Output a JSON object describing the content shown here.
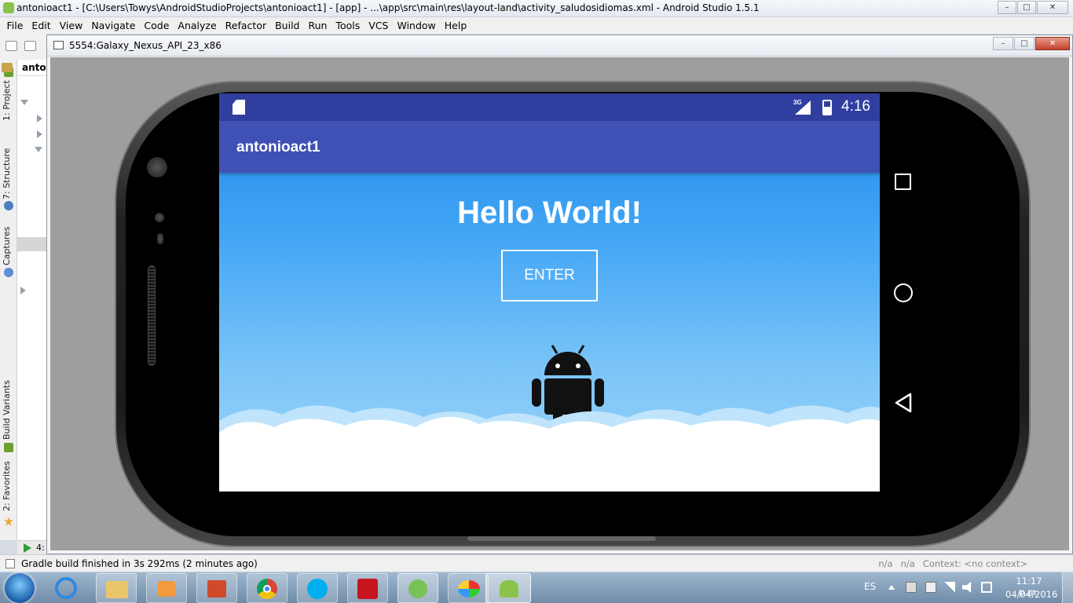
{
  "studio": {
    "window_title": "antonioact1 - [C:\\Users\\Towys\\AndroidStudioProjects\\antonioact1] - [app] - ...\\app\\src\\main\\res\\layout-land\\activity_saludosidiomas.xml - Android Studio 1.5.1",
    "window_buttons": {
      "minimize": "–",
      "maximize": "□",
      "close": "✕"
    },
    "menu": [
      "File",
      "Edit",
      "View",
      "Navigate",
      "Code",
      "Analyze",
      "Refactor",
      "Build",
      "Run",
      "Tools",
      "VCS",
      "Window",
      "Help"
    ],
    "project_label": "anton",
    "side_tabs": {
      "project": "1: Project",
      "structure": "7: Structure",
      "captures": "Captures",
      "build_variants": "Build Variants",
      "favorites": "2: Favorites"
    },
    "run_tab_number": "4:",
    "status_message": "Gradle build finished in 3s 292ms (2 minutes ago)",
    "status_right": [
      "n/a",
      "n/a",
      "Context: <no context>"
    ]
  },
  "emulator": {
    "window_title": "5554:Galaxy_Nexus_API_23_x86",
    "window_buttons": {
      "minimize": "–",
      "maximize": "□",
      "close": "✕"
    },
    "device": {
      "status_bar": {
        "network": "3G",
        "time": "4:16"
      },
      "app_title": "antonioact1",
      "hello_text": "Hello World!",
      "enter_button": "ENTER",
      "colors": {
        "status_bar": "#303f9f",
        "app_bar": "#3f51b5",
        "sky_top": "#1e88e5",
        "sky_bottom": "#9fd6fa"
      }
    },
    "nav_icons": [
      "recents-square-icon",
      "home-circle-icon",
      "back-triangle-icon"
    ]
  },
  "taskbar": {
    "apps": [
      "start-orb",
      "internet-explorer",
      "file-explorer",
      "media-player",
      "control-panel",
      "chrome",
      "skype",
      "acrobat-reader",
      "android-studio",
      "paint",
      "android-emulator"
    ],
    "language": "ES",
    "time": "11:17 p.m.",
    "date": "04/04/2016"
  }
}
